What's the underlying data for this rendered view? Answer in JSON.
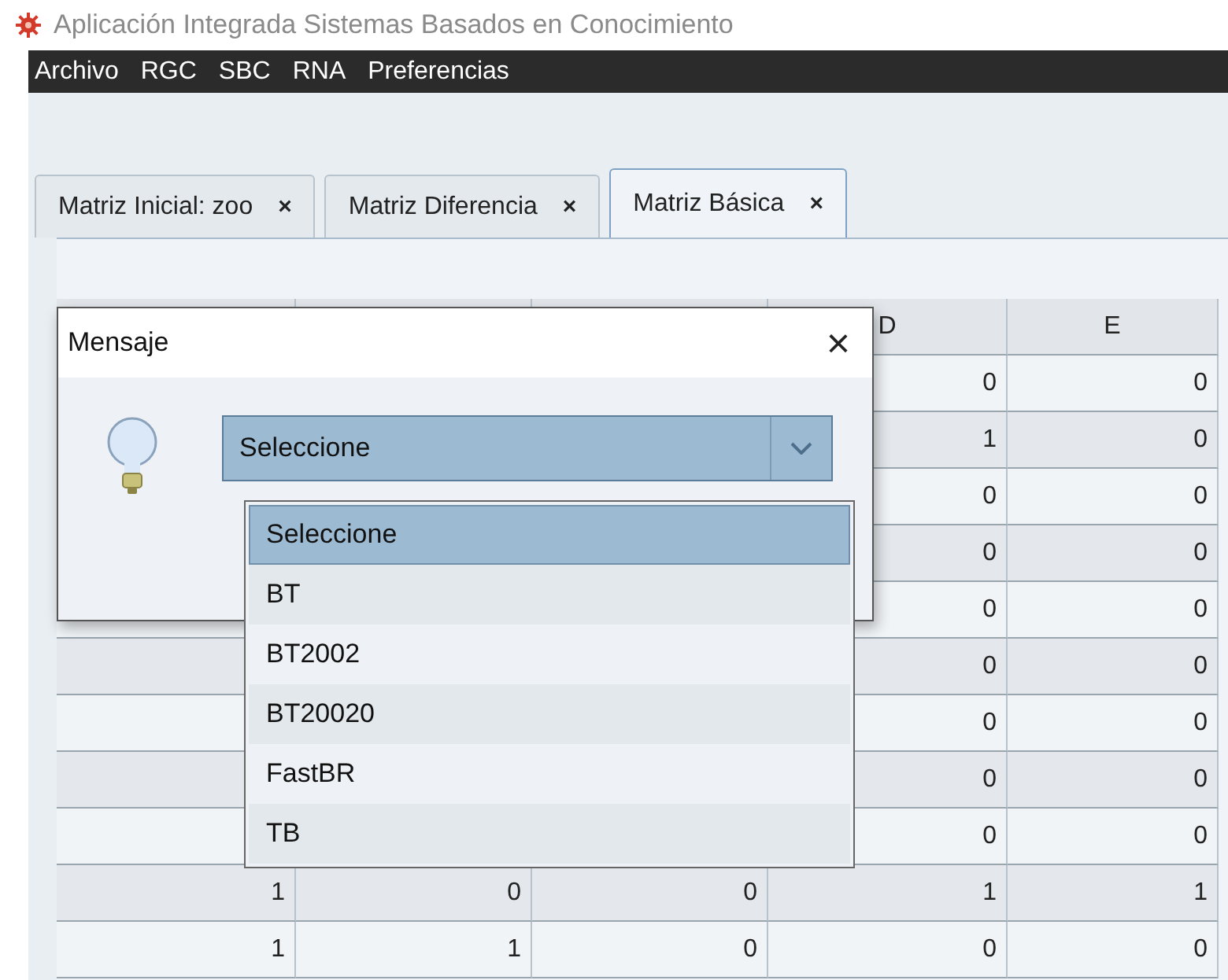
{
  "window": {
    "title": "Aplicación Integrada Sistemas Basados en Conocimiento"
  },
  "menu": [
    "Archivo",
    "RGC",
    "SBC",
    "RNA",
    "Preferencias"
  ],
  "tabs": [
    {
      "label": "Matriz Inicial: zoo",
      "close": "×",
      "selected": false
    },
    {
      "label": "Matriz Diferencia",
      "close": "×",
      "selected": false
    },
    {
      "label": "Matriz Básica",
      "close": "×",
      "selected": true
    }
  ],
  "table": {
    "columns": [
      null,
      null,
      null,
      "D",
      "E"
    ],
    "rows": [
      [
        null,
        null,
        null,
        "0",
        "0"
      ],
      [
        null,
        null,
        null,
        "1",
        "0"
      ],
      [
        null,
        null,
        null,
        "0",
        "0"
      ],
      [
        null,
        null,
        null,
        "0",
        "0"
      ],
      [
        null,
        null,
        null,
        "0",
        "0"
      ],
      [
        null,
        null,
        null,
        "0",
        "0"
      ],
      [
        null,
        null,
        null,
        "0",
        "0"
      ],
      [
        null,
        null,
        null,
        "0",
        "0"
      ],
      [
        null,
        null,
        null,
        "0",
        "0"
      ],
      [
        "1",
        "0",
        "0",
        "1",
        "1"
      ],
      [
        "1",
        "1",
        "0",
        "0",
        "0"
      ]
    ]
  },
  "dialog": {
    "title": "Mensaje",
    "close": "×",
    "combo": {
      "value": "Seleccione",
      "expanded": true,
      "options": [
        {
          "label": "Seleccione",
          "selected": true
        },
        {
          "label": "BT",
          "selected": false
        },
        {
          "label": "BT2002",
          "selected": false
        },
        {
          "label": "BT20020",
          "selected": false
        },
        {
          "label": "FastBR",
          "selected": false
        },
        {
          "label": "TB",
          "selected": false
        }
      ]
    }
  }
}
